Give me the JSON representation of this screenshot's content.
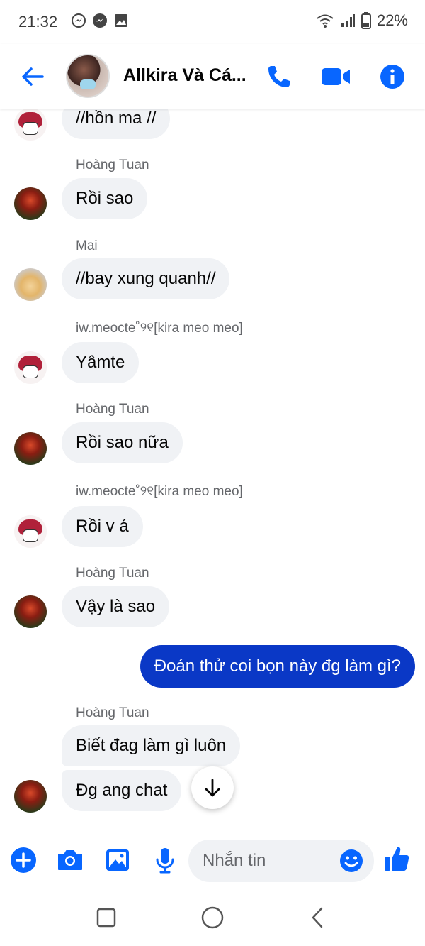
{
  "status_bar": {
    "time": "21:32",
    "battery": "22%"
  },
  "header": {
    "title": "Allkira Và Cá..."
  },
  "messages": [
    {
      "text": "//hồn ma //"
    },
    {
      "sender": "Hoàng Tuan",
      "text": "Rồi sao"
    },
    {
      "sender": "Mai",
      "text": "//bay xung quanh//"
    },
    {
      "sender": "iw.meocte˚୨୧[kira meo meo]",
      "text": "Yâmte"
    },
    {
      "sender": "Hoàng Tuan",
      "text": "Rồi sao nữa"
    },
    {
      "sender": "iw.meocte˚୨୧[kira meo meo]",
      "text": "Rồi v á"
    },
    {
      "sender": "Hoàng Tuan",
      "text": "Vậy là sao"
    },
    {
      "text": "Đoán thử coi bọn này đg làm gì?"
    },
    {
      "sender": "Hoàng Tuan",
      "text": "Biết đag làm gì luôn"
    },
    {
      "text": "Đg ang chat"
    }
  ],
  "composer": {
    "placeholder": "Nhắn tin"
  },
  "colors": {
    "accent": "#0866ff",
    "outgoing_bubble": "#0a38c6",
    "incoming_bubble": "#f0f2f5"
  }
}
